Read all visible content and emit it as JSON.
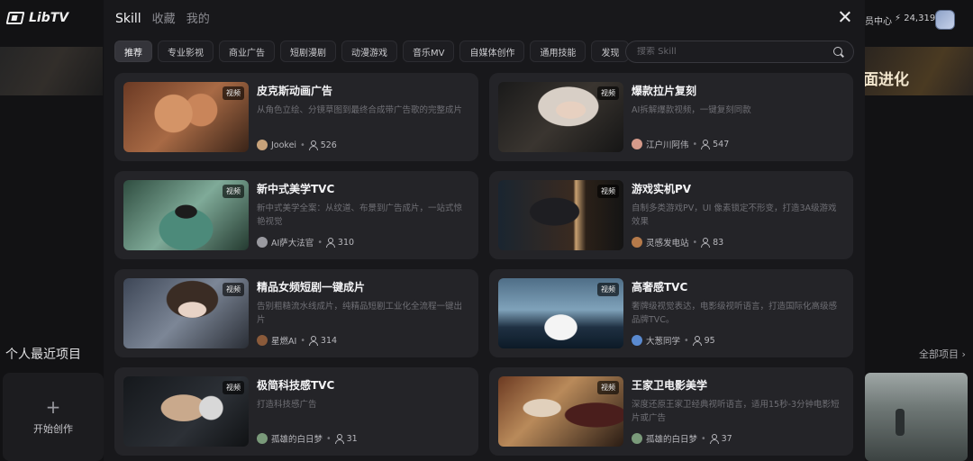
{
  "background": {
    "logo_text": "LibTV",
    "member_center": "员中心",
    "points": "⚡ 24,319",
    "banner_title": "面进化",
    "recent_projects_title": "个人最近项目",
    "view_all": "全部项目 ›",
    "create_label": "开始创作",
    "create_plus": "+"
  },
  "modal": {
    "tabs": [
      {
        "label": "Skill",
        "active": true
      },
      {
        "label": "收藏",
        "active": false
      },
      {
        "label": "我的",
        "active": false
      }
    ],
    "categories": [
      {
        "label": "推荐",
        "active": true
      },
      {
        "label": "专业影视",
        "active": false
      },
      {
        "label": "商业广告",
        "active": false
      },
      {
        "label": "短剧漫剧",
        "active": false
      },
      {
        "label": "动漫游戏",
        "active": false
      },
      {
        "label": "音乐MV",
        "active": false
      },
      {
        "label": "自媒体创作",
        "active": false
      },
      {
        "label": "通用技能",
        "active": false
      },
      {
        "label": "发现",
        "active": false
      }
    ],
    "search_placeholder": "搜索 Skill",
    "video_tag": "视频",
    "cards": [
      {
        "title": "皮克斯动画广告",
        "desc": "从角色立绘、分镜草图到最终合成带广告歌的完整成片",
        "author": "Jookei",
        "count": "526",
        "avatar_color": "#c8a27a"
      },
      {
        "title": "爆款拉片复刻",
        "desc": "AI拆解爆款视频，一键复刻同款",
        "author": "江户川阿伟",
        "count": "547",
        "avatar_color": "#d59a8a"
      },
      {
        "title": "新中式美学TVC",
        "desc": "新中式美学全案：从纹道、布景到广告成片，一站式惊艳视觉",
        "author": "AI萨大法官",
        "count": "310",
        "avatar_color": "#9a9aa0"
      },
      {
        "title": "游戏实机PV",
        "desc": "自制多类游戏PV，UI 像素锁定不形变，打造3A级游戏效果",
        "author": "灵感发电站",
        "count": "83",
        "avatar_color": "#b57a4a"
      },
      {
        "title": "精品女频短剧一键成片",
        "desc": "告别粗糙流水线成片，纯精品短剧工业化全流程一键出片",
        "author": "星燃AI",
        "count": "314",
        "avatar_color": "#8a5a3a"
      },
      {
        "title": "高奢感TVC",
        "desc": "奢牌级视觉表达，电影级视听语言，打造国际化高级感品牌TVC。",
        "author": "大葱同学",
        "count": "95",
        "avatar_color": "#5a8ad0"
      },
      {
        "title": "极简科技感TVC",
        "desc": "打造科技感广告",
        "author": "孤雄的白日梦",
        "count": "31",
        "avatar_color": "#7a9a7a"
      },
      {
        "title": "王家卫电影美学",
        "desc": "深度还原王家卫经典视听语言，适用15秒-3分钟电影短片或广告",
        "author": "孤雄的白日梦",
        "count": "37",
        "avatar_color": "#7a9a7a"
      }
    ]
  }
}
